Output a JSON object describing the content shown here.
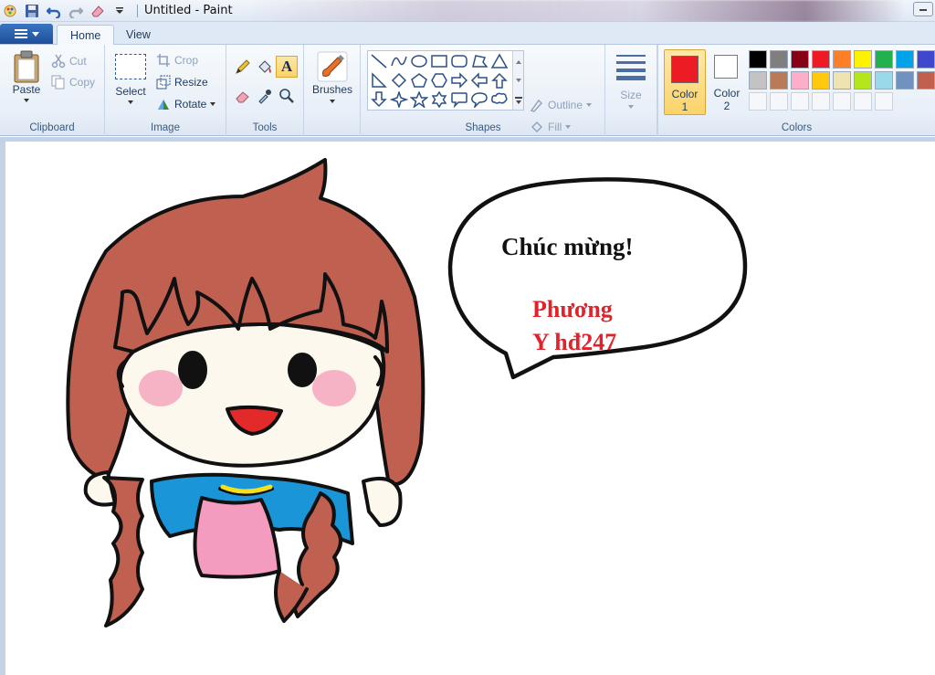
{
  "window": {
    "title": "Untitled - Paint"
  },
  "tabs": [
    {
      "label": "Home"
    },
    {
      "label": "View"
    }
  ],
  "clipboard": {
    "paste": "Paste",
    "cut": "Cut",
    "copy": "Copy",
    "label": "Clipboard"
  },
  "image": {
    "select": "Select",
    "crop": "Crop",
    "resize": "Resize",
    "rotate": "Rotate",
    "label": "Image"
  },
  "tools": {
    "label": "Tools"
  },
  "brushes": {
    "label": "Brushes"
  },
  "shapes": {
    "label": "Shapes",
    "outline": "Outline",
    "fill": "Fill"
  },
  "size": {
    "label": "Size"
  },
  "colors": {
    "label": "Colors",
    "color1_label": "Color",
    "color1_num": "1",
    "color2_label": "Color",
    "color2_num": "2",
    "color1_value": "#ed1c24",
    "color2_value": "#ffffff",
    "palette_row1": [
      "#000000",
      "#7f7f7f",
      "#880015",
      "#ed1c24",
      "#ff7f27",
      "#fff200",
      "#22b14c",
      "#00a2e8",
      "#3f48cc"
    ],
    "palette_row2": [
      "#ffffff",
      "#c3c3c3",
      "#b97a57",
      "#ffaec9",
      "#ffc90e",
      "#efe4b0",
      "#b5e61d",
      "#99d9ea",
      "#7092be"
    ],
    "palette_row3": [
      "#c0604f",
      "#fdf6e3"
    ]
  },
  "canvas": {
    "speech_line1": "Chúc mừng!",
    "speech_line2": "Phương",
    "speech_line3": "Y hđ247"
  }
}
